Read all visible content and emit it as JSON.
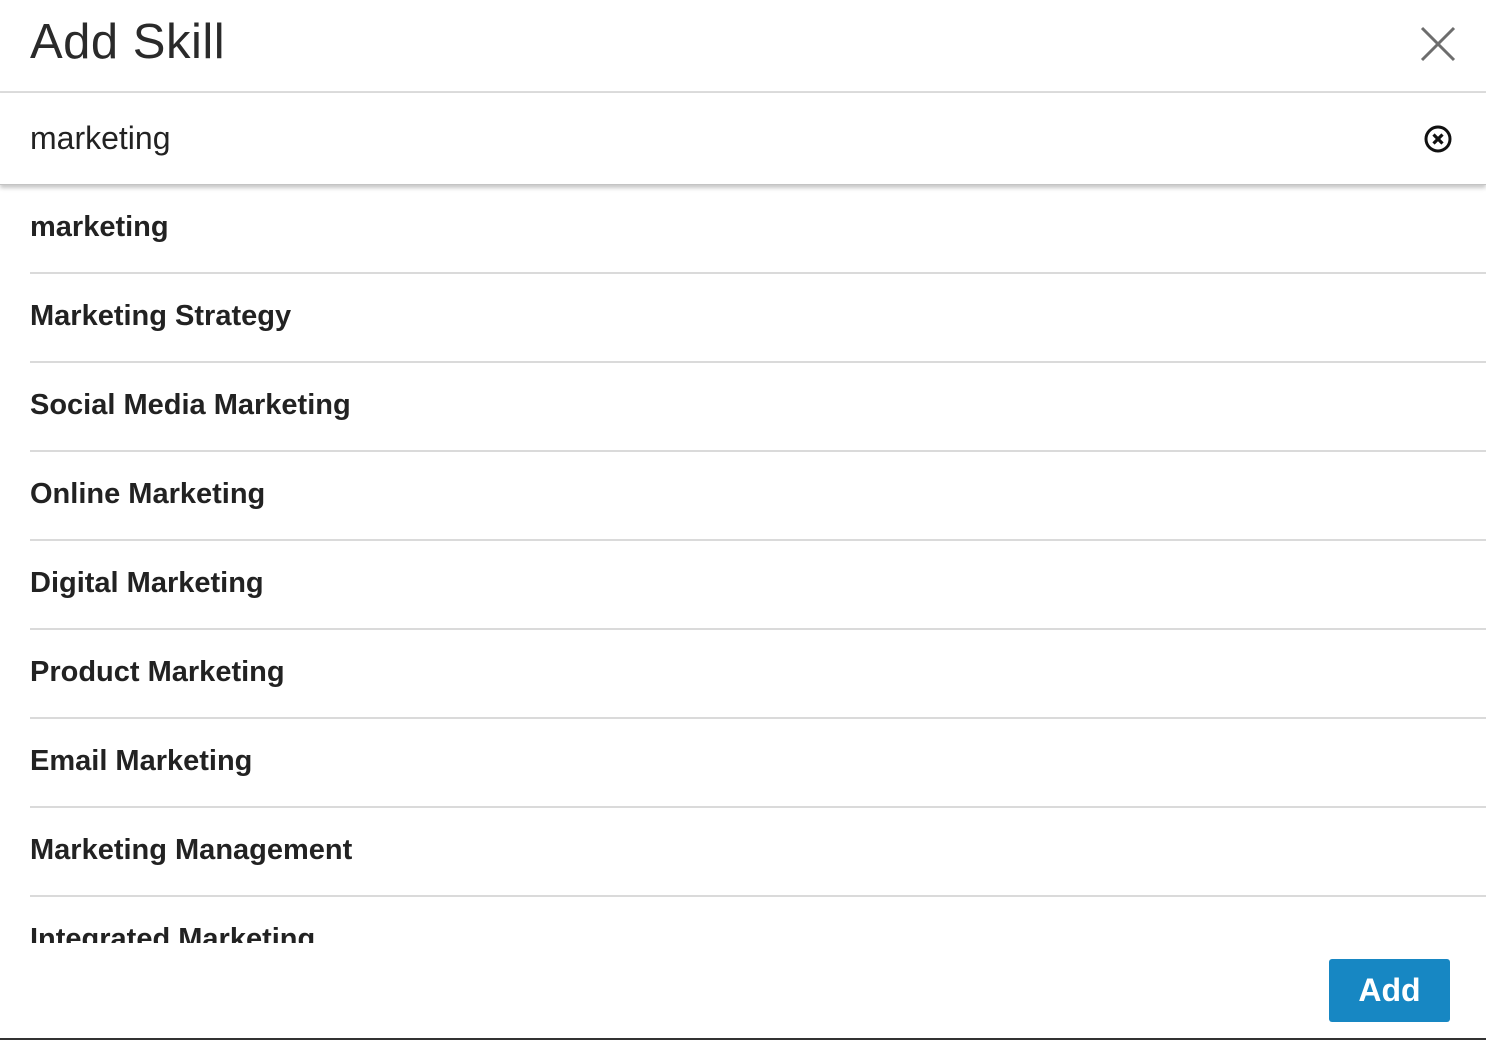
{
  "dialog": {
    "title": "Add Skill",
    "close_icon": "close-icon"
  },
  "search": {
    "value": "marketing",
    "clear_icon": "clear-circle-x-icon"
  },
  "suggestions": [
    {
      "label": "marketing"
    },
    {
      "label": "Marketing Strategy"
    },
    {
      "label": "Social Media Marketing"
    },
    {
      "label": "Online Marketing"
    },
    {
      "label": "Digital Marketing"
    },
    {
      "label": "Product Marketing"
    },
    {
      "label": "Email Marketing"
    },
    {
      "label": "Marketing Management"
    },
    {
      "label": "Integrated Marketing"
    }
  ],
  "footer": {
    "add_label": "Add",
    "accent_color": "#1787c3"
  }
}
